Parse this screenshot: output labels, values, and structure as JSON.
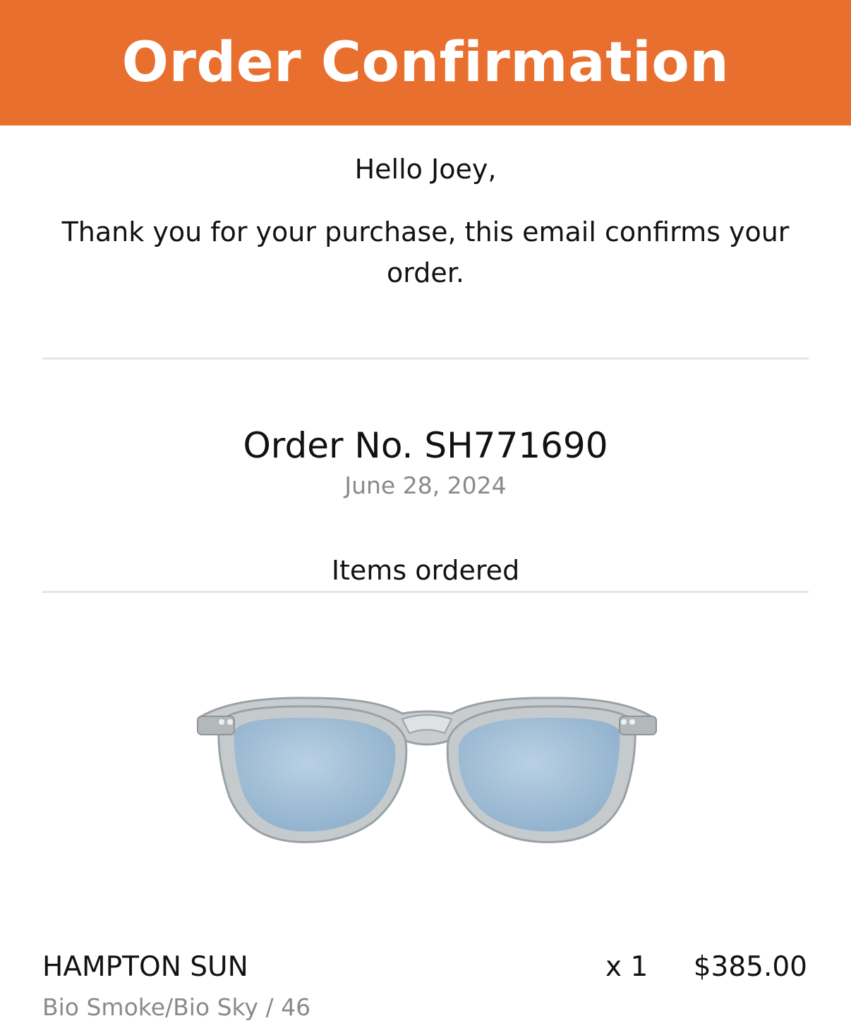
{
  "header": {
    "title": "Order Confirmation",
    "bg_color": "#e96f2f"
  },
  "greeting": "Hello Joey,",
  "message": "Thank you for your purchase, this email confirms your order.",
  "order": {
    "number_label": "Order No. SH771690",
    "date": "June 28, 2024"
  },
  "items_heading": "Items ordered",
  "items": [
    {
      "name": "HAMPTON SUN",
      "variant": "Bio Smoke/Bio Sky / 46",
      "quantity": "x 1",
      "price": "$385.00",
      "image_icon": "sunglasses-icon"
    }
  ]
}
